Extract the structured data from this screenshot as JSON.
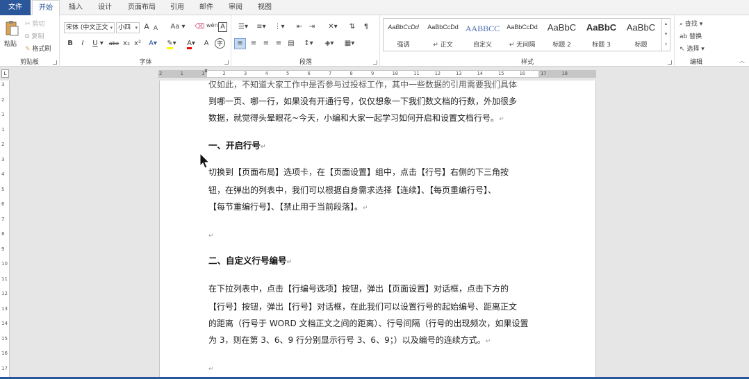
{
  "tabs": [
    "文件",
    "开始",
    "插入",
    "设计",
    "页面布局",
    "引用",
    "邮件",
    "审阅",
    "视图"
  ],
  "clipboard": {
    "paste": "粘贴",
    "cut": "剪切",
    "copy": "复制",
    "format_painter": "格式刷",
    "label": "剪贴板"
  },
  "font": {
    "name": "宋体 (中文正文",
    "size": "小四",
    "change_case": "Aa",
    "label": "字体",
    "bold": "B",
    "italic": "I",
    "underline": "U",
    "strikethrough": "abc",
    "subscript": "x₂",
    "superscript": "x²",
    "grow": "A",
    "shrink": "A",
    "phonetic": "wén",
    "border_char": "A",
    "font_color": "A",
    "circled": "字"
  },
  "paragraph": {
    "label": "段落"
  },
  "styles": {
    "items": [
      {
        "preview": "AaBbCcDd",
        "name": "强调"
      },
      {
        "preview": "AaBbCcDd",
        "name": "↵ 正文"
      },
      {
        "preview": "AABBCC",
        "name": "自定义"
      },
      {
        "preview": "AaBbCcDd",
        "name": "↵ 无间隔"
      },
      {
        "preview": "AaBbC",
        "name": "标题 2"
      },
      {
        "preview": "AaBbC",
        "name": "标题 3"
      },
      {
        "preview": "AaBbC",
        "name": "标题"
      }
    ],
    "label": "样式"
  },
  "editing": {
    "find": "查找",
    "replace": "替换",
    "select": "选择",
    "label": "编辑"
  },
  "ruler": {
    "h_numbers": [
      "2",
      "1",
      "1",
      "2",
      "3",
      "4",
      "5",
      "6",
      "7",
      "8",
      "9",
      "10",
      "11",
      "12",
      "13",
      "14",
      "15",
      "16",
      "17",
      "18"
    ],
    "v_numbers": [
      "3",
      "2",
      "1",
      "1",
      "2",
      "3",
      "4",
      "5",
      "6",
      "7",
      "8",
      "9",
      "10",
      "11",
      "12",
      "13",
      "14",
      "15",
      "16",
      "17"
    ]
  },
  "document": {
    "lines": [
      "仅如此，不知道大家工作中是否参与过投标工作，其中一些数据的引用需要我们具体",
      "到哪一页、哪一行，如果没有开通行号，仅仅想象一下我们数文档的行数，外加很多",
      "数据，就觉得头晕眼花~今天，小编和大家一起学习如何开启和设置文档行号。",
      "一、开启行号",
      "切换到【页面布局】选项卡，在【页面设置】组中，点击【行号】右侧的下三角按",
      "钮，在弹出的列表中，我们可以根据自身需求选择【连续】、【每页重编行号】、",
      "【每节重编行号】、【禁止用于当前段落】。",
      "",
      "二、自定义行号编号",
      "在下拉列表中，点击【行编号选项】按钮，弹出【页面设置】对话框，点击下方的",
      "【行号】按钮，弹出【行号】对话框，在此我们可以设置行号的起始编号、距离正文",
      "的距离（行号于 WORD 文档正文之间的距离）、行号间隔（行号的出现频次，如果设置",
      "为 3，则在第 3、6、9 行分别显示行号 3、6、9；）以及编号的连续方式。",
      ""
    ],
    "paragraph_mark": "↵"
  }
}
